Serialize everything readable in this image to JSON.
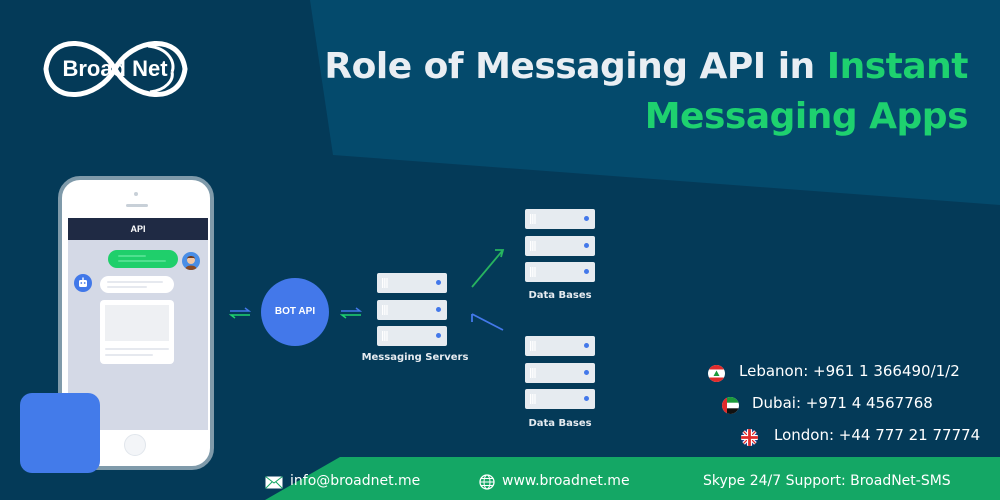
{
  "brand": {
    "logo_text": "Broad Net"
  },
  "title": {
    "line1_white": "Role of Messaging API in ",
    "line1_green": "Instant",
    "line2_green": "Messaging Apps"
  },
  "phone": {
    "header_label": "API",
    "user_avatar_icon": "user-avatar-icon",
    "bot_avatar_icon": "robot-icon"
  },
  "diagram": {
    "bot_api_label": "BOT API",
    "messaging_servers_label": "Messaging Servers",
    "databases_top_label": "Data Bases",
    "databases_bottom_label": "Data Bases"
  },
  "contacts": [
    {
      "flag": "lebanon-flag-icon",
      "text": "Lebanon: +961 1 366490/1/2"
    },
    {
      "flag": "uae-flag-icon",
      "text": "Dubai: +971 4 4567768"
    },
    {
      "flag": "uk-flag-icon",
      "text": "London: +44 777 21 77774"
    }
  ],
  "footer": {
    "email": "info@broadnet.me",
    "website": "www.broadnet.me",
    "skype": "Skype 24/7 Support: BroadNet-SMS"
  },
  "colors": {
    "background": "#043a58",
    "accent_green": "#1ed16f",
    "footer_green": "#14a765",
    "accent_blue": "#4378ea"
  }
}
